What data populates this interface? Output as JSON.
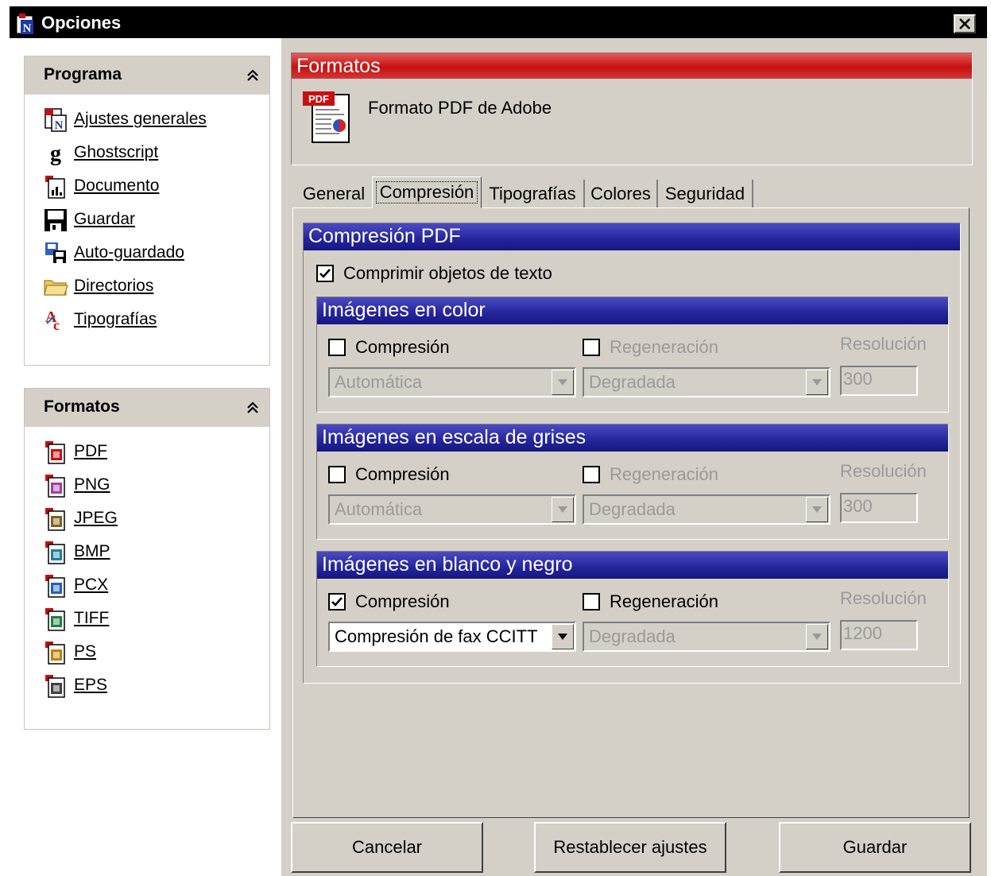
{
  "window": {
    "title": "Opciones"
  },
  "sidebar": {
    "programa": {
      "title": "Programa",
      "items": [
        {
          "label": "Ajustes generales",
          "icon": "settings-doc-icon"
        },
        {
          "label": "Ghostscript",
          "icon": "ghostscript-icon"
        },
        {
          "label": "Documento",
          "icon": "document-icon"
        },
        {
          "label": "Guardar",
          "icon": "save-icon"
        },
        {
          "label": "Auto-guardado",
          "icon": "autosave-icon"
        },
        {
          "label": "Directorios",
          "icon": "folder-icon"
        },
        {
          "label": "Tipografías",
          "icon": "fonts-icon"
        }
      ]
    },
    "formatos": {
      "title": "Formatos",
      "items": [
        {
          "label": "PDF",
          "icon": "pdf-file-icon",
          "color": "#c81010"
        },
        {
          "label": "PNG",
          "icon": "png-file-icon",
          "color": "#a040a0"
        },
        {
          "label": "JPEG",
          "icon": "jpeg-file-icon",
          "color": "#806020"
        },
        {
          "label": "BMP",
          "icon": "bmp-file-icon",
          "color": "#2080a0"
        },
        {
          "label": "PCX",
          "icon": "pcx-file-icon",
          "color": "#2060c0"
        },
        {
          "label": "TIFF",
          "icon": "tiff-file-icon",
          "color": "#208040"
        },
        {
          "label": "PS",
          "icon": "ps-file-icon",
          "color": "#c08000"
        },
        {
          "label": "EPS",
          "icon": "eps-file-icon",
          "color": "#404040"
        }
      ]
    }
  },
  "format_panel": {
    "title": "Formatos",
    "subtitle": "Formato PDF de Adobe",
    "badge": "PDF"
  },
  "tabs": [
    {
      "label": "General"
    },
    {
      "label": "Compresión",
      "active": true
    },
    {
      "label": "Tipografías"
    },
    {
      "label": "Colores"
    },
    {
      "label": "Seguridad"
    }
  ],
  "compression": {
    "title": "Compresión PDF",
    "compress_text": {
      "label": "Comprimir objetos de texto",
      "checked": true
    },
    "groups": [
      {
        "title": "Imágenes en color",
        "compression": {
          "label": "Compresión",
          "checked": false
        },
        "regeneration": {
          "label": "Regeneración",
          "checked": false,
          "enabled": false
        },
        "resolution_label": "Resolución",
        "method": "Automática",
        "method_enabled": false,
        "downsample": "Degradada",
        "resolution": "300"
      },
      {
        "title": "Imágenes en escala de grises",
        "compression": {
          "label": "Compresión",
          "checked": false
        },
        "regeneration": {
          "label": "Regeneración",
          "checked": false,
          "enabled": false
        },
        "resolution_label": "Resolución",
        "method": "Automática",
        "method_enabled": false,
        "downsample": "Degradada",
        "resolution": "300"
      },
      {
        "title": "Imágenes en blanco y negro",
        "compression": {
          "label": "Compresión",
          "checked": true
        },
        "regeneration": {
          "label": "Regeneración",
          "checked": false,
          "enabled": true
        },
        "resolution_label": "Resolución",
        "method": "Compresión de fax CCITT",
        "method_enabled": true,
        "downsample": "Degradada",
        "resolution": "1200"
      }
    ]
  },
  "buttons": {
    "cancel": "Cancelar",
    "reset": "Restablecer ajustes",
    "save": "Guardar"
  },
  "colors": {
    "titlebar": "#000000",
    "face": "#d4d0c8",
    "red_header": "#c81010",
    "blue_header": "#24249a",
    "disabled_text": "#9a9a9a"
  }
}
